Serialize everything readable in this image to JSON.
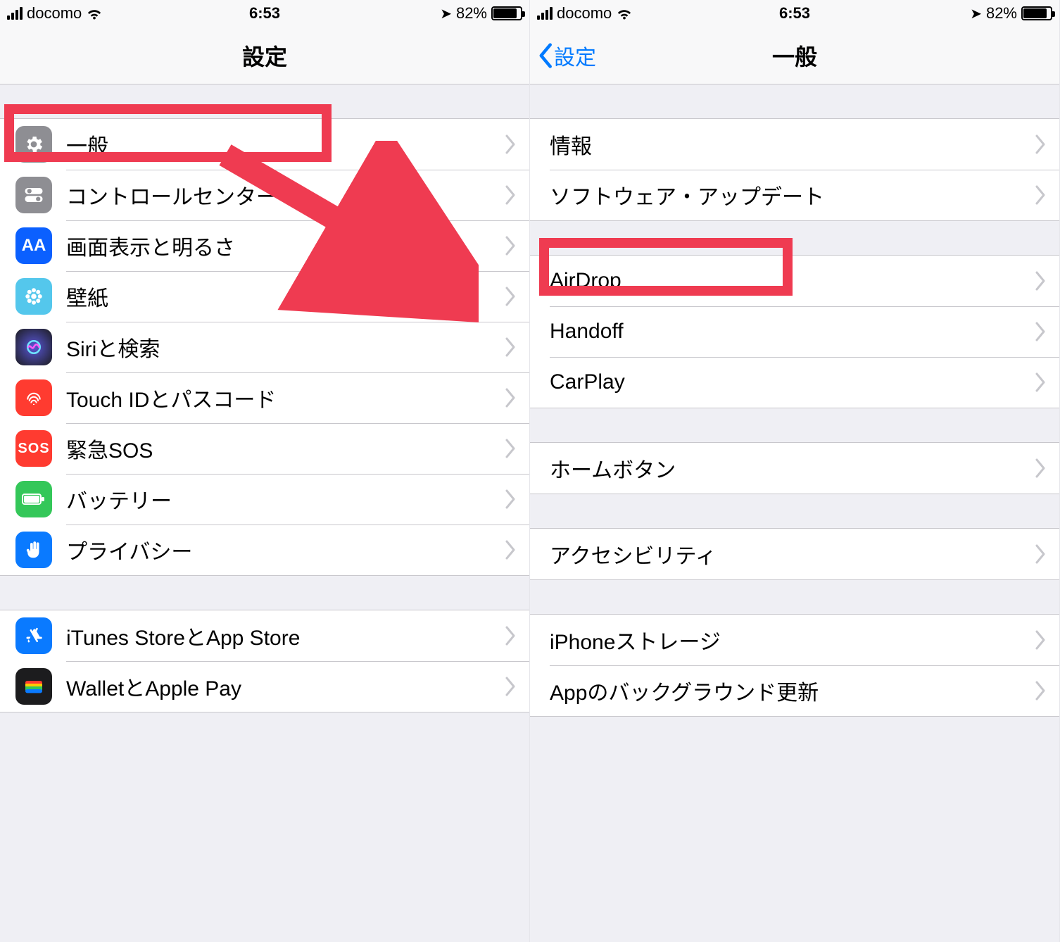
{
  "status": {
    "carrier": "docomo",
    "time": "6:53",
    "battery_pct": "82%"
  },
  "left": {
    "title": "設定",
    "groups": [
      [
        {
          "id": "general",
          "label": "一般"
        },
        {
          "id": "control-center",
          "label": "コントロールセンター"
        },
        {
          "id": "display",
          "label": "画面表示と明るさ"
        },
        {
          "id": "wallpaper",
          "label": "壁紙"
        },
        {
          "id": "siri",
          "label": "Siriと検索"
        },
        {
          "id": "touchid",
          "label": "Touch IDとパスコード"
        },
        {
          "id": "sos",
          "label": "緊急SOS"
        },
        {
          "id": "battery",
          "label": "バッテリー"
        },
        {
          "id": "privacy",
          "label": "プライバシー"
        }
      ],
      [
        {
          "id": "itunes",
          "label": "iTunes StoreとApp Store"
        },
        {
          "id": "wallet",
          "label": "WalletとApple Pay"
        }
      ]
    ],
    "sos_text": "SOS"
  },
  "right": {
    "back_label": "設定",
    "title": "一般",
    "groups": [
      [
        {
          "id": "about",
          "label": "情報"
        },
        {
          "id": "swupdate",
          "label": "ソフトウェア・アップデート"
        }
      ],
      [
        {
          "id": "airdrop",
          "label": "AirDrop"
        },
        {
          "id": "handoff",
          "label": "Handoff"
        },
        {
          "id": "carplay",
          "label": "CarPlay"
        }
      ],
      [
        {
          "id": "homebutton",
          "label": "ホームボタン"
        }
      ],
      [
        {
          "id": "accessibility",
          "label": "アクセシビリティ"
        }
      ],
      [
        {
          "id": "storage",
          "label": "iPhoneストレージ"
        },
        {
          "id": "bgrefresh",
          "label": "Appのバックグラウンド更新"
        }
      ]
    ]
  }
}
